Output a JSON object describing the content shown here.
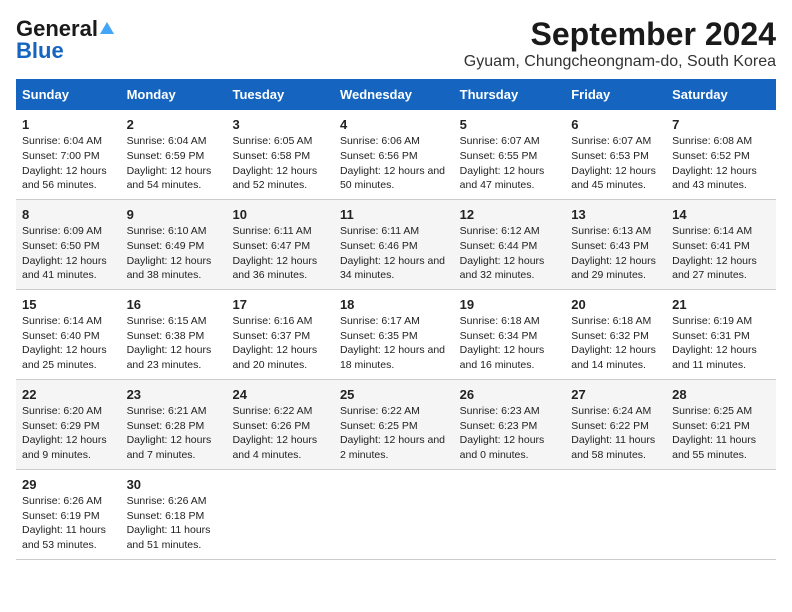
{
  "logo": {
    "general": "General",
    "blue": "Blue"
  },
  "title": "September 2024",
  "subtitle": "Gyuam, Chungcheongnam-do, South Korea",
  "days": [
    "Sunday",
    "Monday",
    "Tuesday",
    "Wednesday",
    "Thursday",
    "Friday",
    "Saturday"
  ],
  "weeks": [
    [
      {
        "num": "1",
        "sunrise": "6:04 AM",
        "sunset": "7:00 PM",
        "daylight": "12 hours and 56 minutes."
      },
      {
        "num": "2",
        "sunrise": "6:04 AM",
        "sunset": "6:59 PM",
        "daylight": "12 hours and 54 minutes."
      },
      {
        "num": "3",
        "sunrise": "6:05 AM",
        "sunset": "6:58 PM",
        "daylight": "12 hours and 52 minutes."
      },
      {
        "num": "4",
        "sunrise": "6:06 AM",
        "sunset": "6:56 PM",
        "daylight": "12 hours and 50 minutes."
      },
      {
        "num": "5",
        "sunrise": "6:07 AM",
        "sunset": "6:55 PM",
        "daylight": "12 hours and 47 minutes."
      },
      {
        "num": "6",
        "sunrise": "6:07 AM",
        "sunset": "6:53 PM",
        "daylight": "12 hours and 45 minutes."
      },
      {
        "num": "7",
        "sunrise": "6:08 AM",
        "sunset": "6:52 PM",
        "daylight": "12 hours and 43 minutes."
      }
    ],
    [
      {
        "num": "8",
        "sunrise": "6:09 AM",
        "sunset": "6:50 PM",
        "daylight": "12 hours and 41 minutes."
      },
      {
        "num": "9",
        "sunrise": "6:10 AM",
        "sunset": "6:49 PM",
        "daylight": "12 hours and 38 minutes."
      },
      {
        "num": "10",
        "sunrise": "6:11 AM",
        "sunset": "6:47 PM",
        "daylight": "12 hours and 36 minutes."
      },
      {
        "num": "11",
        "sunrise": "6:11 AM",
        "sunset": "6:46 PM",
        "daylight": "12 hours and 34 minutes."
      },
      {
        "num": "12",
        "sunrise": "6:12 AM",
        "sunset": "6:44 PM",
        "daylight": "12 hours and 32 minutes."
      },
      {
        "num": "13",
        "sunrise": "6:13 AM",
        "sunset": "6:43 PM",
        "daylight": "12 hours and 29 minutes."
      },
      {
        "num": "14",
        "sunrise": "6:14 AM",
        "sunset": "6:41 PM",
        "daylight": "12 hours and 27 minutes."
      }
    ],
    [
      {
        "num": "15",
        "sunrise": "6:14 AM",
        "sunset": "6:40 PM",
        "daylight": "12 hours and 25 minutes."
      },
      {
        "num": "16",
        "sunrise": "6:15 AM",
        "sunset": "6:38 PM",
        "daylight": "12 hours and 23 minutes."
      },
      {
        "num": "17",
        "sunrise": "6:16 AM",
        "sunset": "6:37 PM",
        "daylight": "12 hours and 20 minutes."
      },
      {
        "num": "18",
        "sunrise": "6:17 AM",
        "sunset": "6:35 PM",
        "daylight": "12 hours and 18 minutes."
      },
      {
        "num": "19",
        "sunrise": "6:18 AM",
        "sunset": "6:34 PM",
        "daylight": "12 hours and 16 minutes."
      },
      {
        "num": "20",
        "sunrise": "6:18 AM",
        "sunset": "6:32 PM",
        "daylight": "12 hours and 14 minutes."
      },
      {
        "num": "21",
        "sunrise": "6:19 AM",
        "sunset": "6:31 PM",
        "daylight": "12 hours and 11 minutes."
      }
    ],
    [
      {
        "num": "22",
        "sunrise": "6:20 AM",
        "sunset": "6:29 PM",
        "daylight": "12 hours and 9 minutes."
      },
      {
        "num": "23",
        "sunrise": "6:21 AM",
        "sunset": "6:28 PM",
        "daylight": "12 hours and 7 minutes."
      },
      {
        "num": "24",
        "sunrise": "6:22 AM",
        "sunset": "6:26 PM",
        "daylight": "12 hours and 4 minutes."
      },
      {
        "num": "25",
        "sunrise": "6:22 AM",
        "sunset": "6:25 PM",
        "daylight": "12 hours and 2 minutes."
      },
      {
        "num": "26",
        "sunrise": "6:23 AM",
        "sunset": "6:23 PM",
        "daylight": "12 hours and 0 minutes."
      },
      {
        "num": "27",
        "sunrise": "6:24 AM",
        "sunset": "6:22 PM",
        "daylight": "11 hours and 58 minutes."
      },
      {
        "num": "28",
        "sunrise": "6:25 AM",
        "sunset": "6:21 PM",
        "daylight": "11 hours and 55 minutes."
      }
    ],
    [
      {
        "num": "29",
        "sunrise": "6:26 AM",
        "sunset": "6:19 PM",
        "daylight": "11 hours and 53 minutes."
      },
      {
        "num": "30",
        "sunrise": "6:26 AM",
        "sunset": "6:18 PM",
        "daylight": "11 hours and 51 minutes."
      },
      null,
      null,
      null,
      null,
      null
    ]
  ]
}
